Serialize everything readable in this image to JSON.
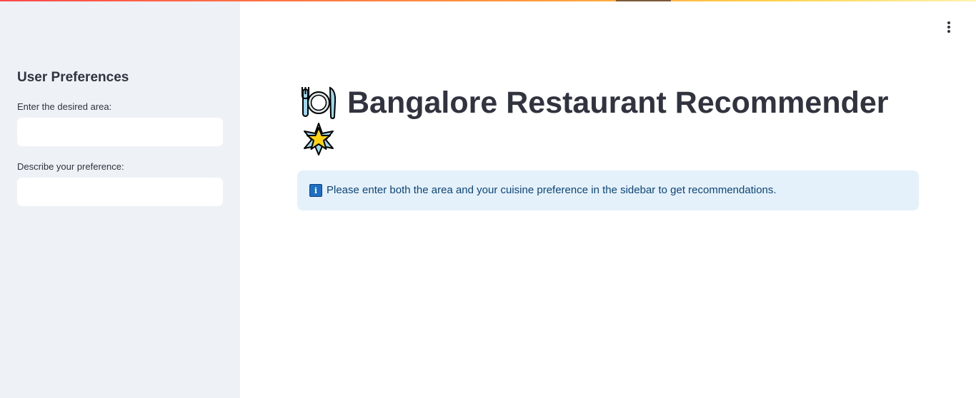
{
  "sidebar": {
    "title": "User Preferences",
    "area_field": {
      "label": "Enter the desired area:",
      "value": "",
      "placeholder": ""
    },
    "preference_field": {
      "label": "Describe your preference:",
      "value": "",
      "placeholder": ""
    }
  },
  "main": {
    "title": "Bangalore Restaurant Recommender",
    "title_icons": [
      "plate-with-cutlery-icon",
      "glowing-star-icon"
    ],
    "info": {
      "icon": "info-icon",
      "icon_glyph": "i",
      "text": "Please enter both the area and your cuisine preference in the sidebar to get recommendations."
    },
    "menu_icon": "kebab-menu-icon"
  },
  "colors": {
    "sidebar_bg": "#eef1f5",
    "info_bg": "#e4f1fb",
    "info_text": "#0d4478",
    "text": "#31333f",
    "accent_stripe_start": "#ff4b4b",
    "accent_stripe_end": "#fff3b0"
  }
}
